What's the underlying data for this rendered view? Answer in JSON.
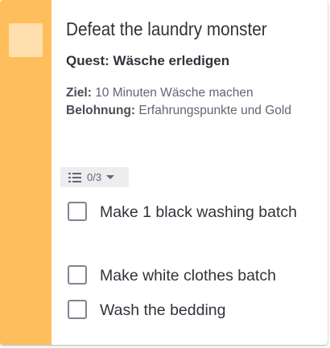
{
  "task": {
    "title": "Defeat the laundry monster",
    "quest": "Quest: Wäsche erledigen",
    "goal_label": "Ziel:",
    "goal_text": "10 Minuten Wäsche machen",
    "reward_label": "Belohnung:",
    "reward_text": "Erfahrungspunkte und Gold",
    "accent_color": "#FFBE5C",
    "checklist_progress": "0/3",
    "checklist_icon": "list-icon",
    "checklist": [
      {
        "label": "Make 1 black washing batch",
        "checked": false
      },
      {
        "label": "Make white clothes batch",
        "checked": false
      },
      {
        "label": "Wash the bedding",
        "checked": false
      }
    ]
  }
}
